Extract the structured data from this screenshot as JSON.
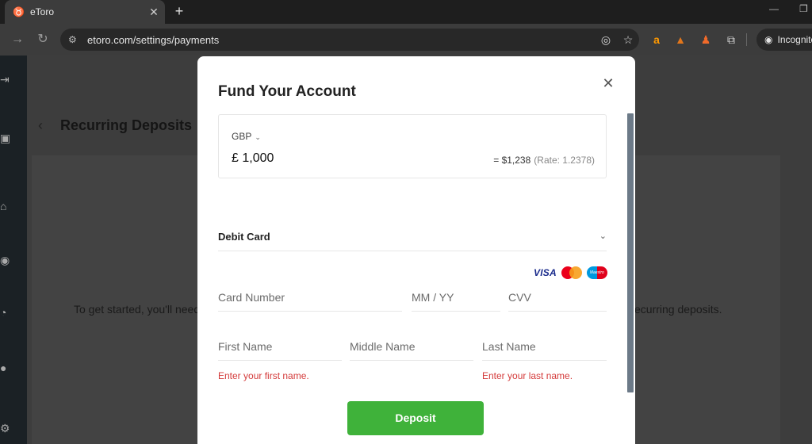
{
  "browser": {
    "tab_title": "eToro",
    "tab_favicon": "bull",
    "url": "etoro.com/settings/payments",
    "incognito_label": "Incognito"
  },
  "page": {
    "title": "Recurring Deposits",
    "body_text_left": "To get started, you'll need",
    "body_text_right": "ecurring deposits."
  },
  "modal": {
    "title": "Fund Your Account",
    "currency": "GBP",
    "amount": "£ 1,000",
    "converted": "= $1,238",
    "rate": "(Rate: 1.2378)",
    "payment_method": "Debit Card",
    "card_brands": [
      "VISA",
      "Mastercard",
      "Maestro"
    ],
    "fields": {
      "card_number": "Card Number",
      "expiry": "MM / YY",
      "cvv": "CVV",
      "first_name": "First Name",
      "middle_name": "Middle Name",
      "last_name": "Last Name"
    },
    "errors": {
      "first_name": "Enter your first name.",
      "last_name": "Enter your last name."
    },
    "deposit_label": "Deposit"
  },
  "colors": {
    "accent_green": "#3fb23a",
    "error_red": "#d43b3b"
  }
}
